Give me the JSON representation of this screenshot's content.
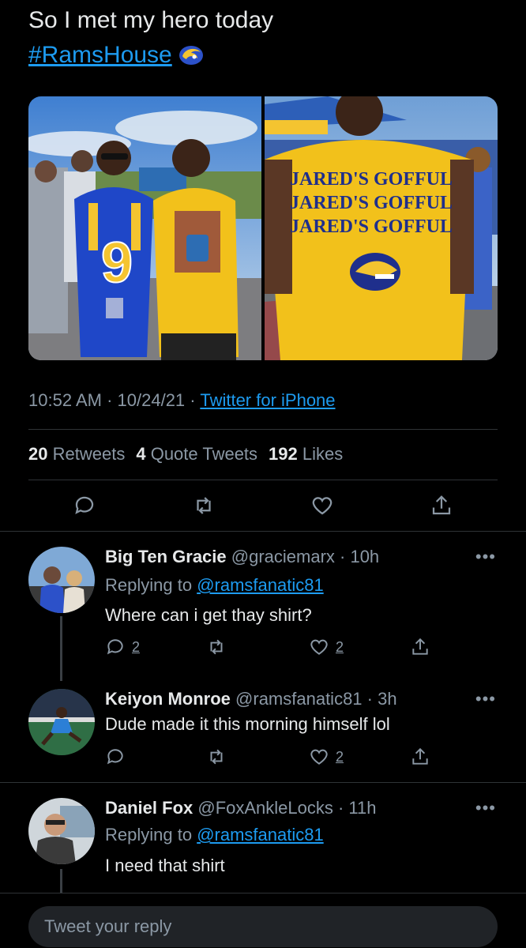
{
  "tweet": {
    "line1": "So I met my hero today",
    "hashtag": "#RamsHouse",
    "shirt_text": "JARED'S GOFFUL",
    "jersey_number": "9",
    "time": "10:52 AM",
    "date": "10/24/21",
    "sep": "·",
    "source": "Twitter for iPhone",
    "retweets_count": "20",
    "retweets_label": "Retweets",
    "quotes_count": "4",
    "quotes_label": "Quote Tweets",
    "likes_count": "192",
    "likes_label": "Likes"
  },
  "replies": [
    {
      "name": "Big Ten Gracie",
      "handle": "@graciemarx · 10h",
      "replying_prefix": "Replying to ",
      "replying_to": "@ramsfanatic81",
      "text": "Where can i get thay shirt?",
      "reply_count": "2",
      "like_count": "2"
    },
    {
      "name": "Keiyon Monroe",
      "handle": "@ramsfanatic81 · 3h",
      "text": "Dude made it this morning himself lol",
      "like_count": "2"
    },
    {
      "name": "Daniel Fox",
      "handle": "@FoxAnkleLocks · 11h",
      "replying_prefix": "Replying to ",
      "replying_to": "@ramsfanatic81",
      "text": "I need that shirt"
    }
  ],
  "more_label": "•••",
  "composer": {
    "placeholder": "Tweet your reply"
  },
  "colors": {
    "accent": "#1d9bf0",
    "muted": "#8b98a5",
    "rams_blue": "#2c51c9",
    "rams_gold": "#f4c430"
  },
  "icons": [
    "reply-icon",
    "retweet-icon",
    "like-icon",
    "share-icon",
    "more-icon",
    "rams-logo-icon"
  ]
}
